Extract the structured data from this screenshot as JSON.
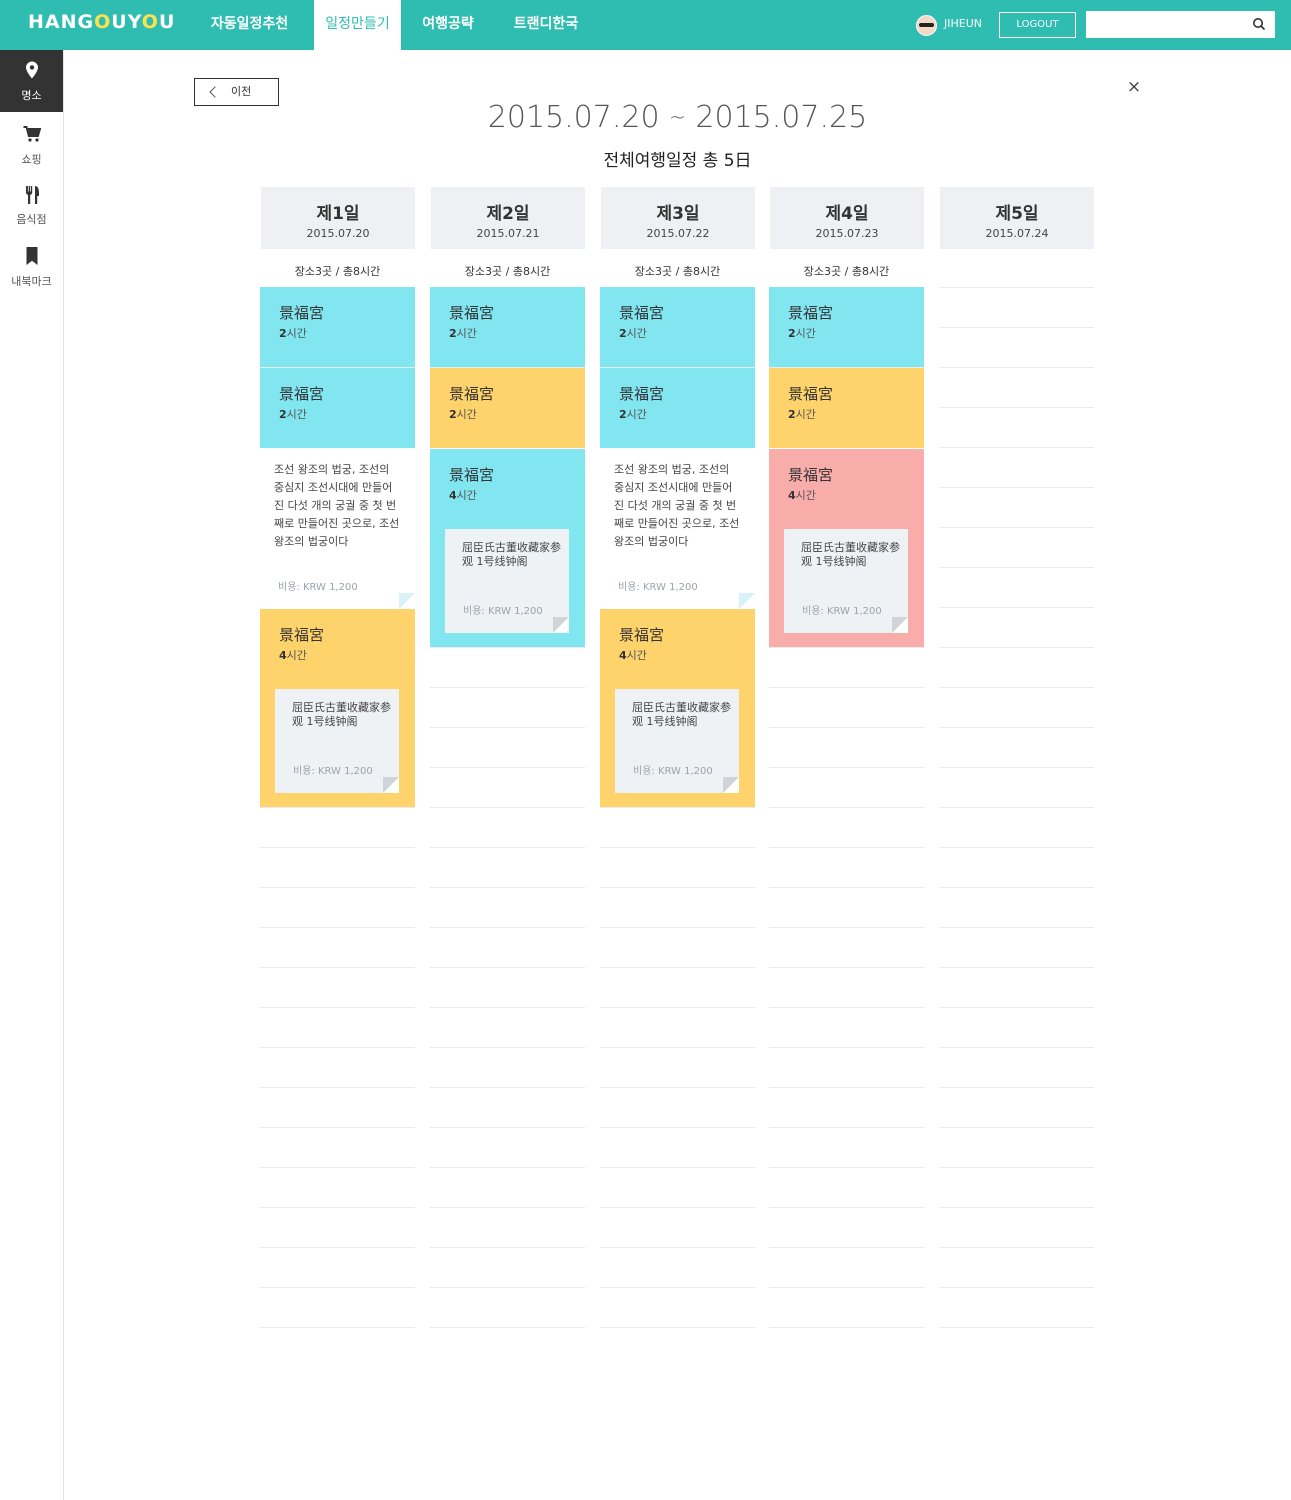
{
  "topbar": {
    "logo_text": "HANG",
    "logo_o1": "O",
    "logo_mid": "UY",
    "logo_o2": "O",
    "logo_end": "U",
    "nav": [
      "자동일정추천",
      "일정만들기",
      "여행공략",
      "트랜디한국"
    ],
    "active_nav": 1,
    "username": "JIHEUN",
    "logout_label": "LOGOUT",
    "search_value": ""
  },
  "sidebar": {
    "items": [
      {
        "label": "명소",
        "icon": "map-pin-icon",
        "active": true
      },
      {
        "label": "쇼핑",
        "icon": "shopping-cart-icon",
        "active": false
      },
      {
        "label": "음식점",
        "icon": "fork-knife-icon",
        "active": false
      },
      {
        "label": "내북마크",
        "icon": "bookmark-icon",
        "active": false
      }
    ]
  },
  "header": {
    "prev_label": "이전",
    "close_symbol": "×",
    "start_date": "2015.07.20",
    "range_sep": "~",
    "end_date": "2015.07.25",
    "subtitle": "전체여행일정 총 5日"
  },
  "days": [
    {
      "title": "제1일",
      "date": "2015.07.20",
      "summary": "장소3곳 / 총8시간",
      "blocks": [
        {
          "kind": "place",
          "color": "cyan",
          "name": "景福宮",
          "hours": "2",
          "unit": "시간"
        },
        {
          "kind": "place",
          "color": "cyan",
          "name": "景福宮",
          "hours": "2",
          "unit": "시간"
        },
        {
          "kind": "desc",
          "text": "조선 왕조의 법궁, 조선의 중심지 조선시대에 만들어진 다섯 개의 궁궐 중 첫 번째로 만들어진 곳으로, 조선 왕조의 법궁이다",
          "cost": "비용: KRW 1,200"
        },
        {
          "kind": "place_note",
          "color": "yellow",
          "name": "景福宮",
          "hours": "4",
          "unit": "시간",
          "note": "屈臣氏古董收藏家参观 1号线钟阁",
          "cost": "비용: KRW 1,200"
        }
      ]
    },
    {
      "title": "제2일",
      "date": "2015.07.21",
      "summary": "장소3곳 / 총8시간",
      "blocks": [
        {
          "kind": "place",
          "color": "cyan",
          "name": "景福宮",
          "hours": "2",
          "unit": "시간"
        },
        {
          "kind": "place",
          "color": "yellow",
          "name": "景福宮",
          "hours": "2",
          "unit": "시간"
        },
        {
          "kind": "place_note",
          "color": "cyan",
          "name": "景福宮",
          "hours": "4",
          "unit": "시간",
          "note": "屈臣氏古董收藏家参观 1号线钟阁",
          "cost": "비용: KRW 1,200"
        }
      ]
    },
    {
      "title": "제3일",
      "date": "2015.07.22",
      "summary": "장소3곳 / 총8시간",
      "blocks": [
        {
          "kind": "place",
          "color": "cyan",
          "name": "景福宮",
          "hours": "2",
          "unit": "시간"
        },
        {
          "kind": "place",
          "color": "cyan",
          "name": "景福宮",
          "hours": "2",
          "unit": "시간"
        },
        {
          "kind": "desc",
          "text": "조선 왕조의 법궁, 조선의 중심지 조선시대에 만들어진 다섯 개의 궁궐 중 첫 번째로 만들어진 곳으로, 조선 왕조의 법궁이다",
          "cost": "비용: KRW 1,200"
        },
        {
          "kind": "place_note",
          "color": "yellow",
          "name": "景福宮",
          "hours": "4",
          "unit": "시간",
          "note": "屈臣氏古董收藏家参观 1号线钟阁",
          "cost": "비용: KRW 1,200"
        }
      ]
    },
    {
      "title": "제4일",
      "date": "2015.07.23",
      "summary": "장소3곳 / 총8시간",
      "blocks": [
        {
          "kind": "place",
          "color": "cyan",
          "name": "景福宮",
          "hours": "2",
          "unit": "시간"
        },
        {
          "kind": "place",
          "color": "yellow",
          "name": "景福宮",
          "hours": "2",
          "unit": "시간"
        },
        {
          "kind": "place_note",
          "color": "pink",
          "name": "景福宮",
          "hours": "4",
          "unit": "시간",
          "note": "屈臣氏古董收藏家参观 1号线钟阁",
          "cost": "비용: KRW 1,200"
        }
      ]
    },
    {
      "title": "제5일",
      "date": "2015.07.24",
      "summary": "",
      "blocks": []
    }
  ],
  "colors": {
    "brand": "#2fbdb1",
    "cyan": "#82e6f1",
    "yellow": "#fed36b",
    "pink": "#f9adab",
    "header_bg": "#eef0f3",
    "logo_accent": "#ffe14d"
  }
}
